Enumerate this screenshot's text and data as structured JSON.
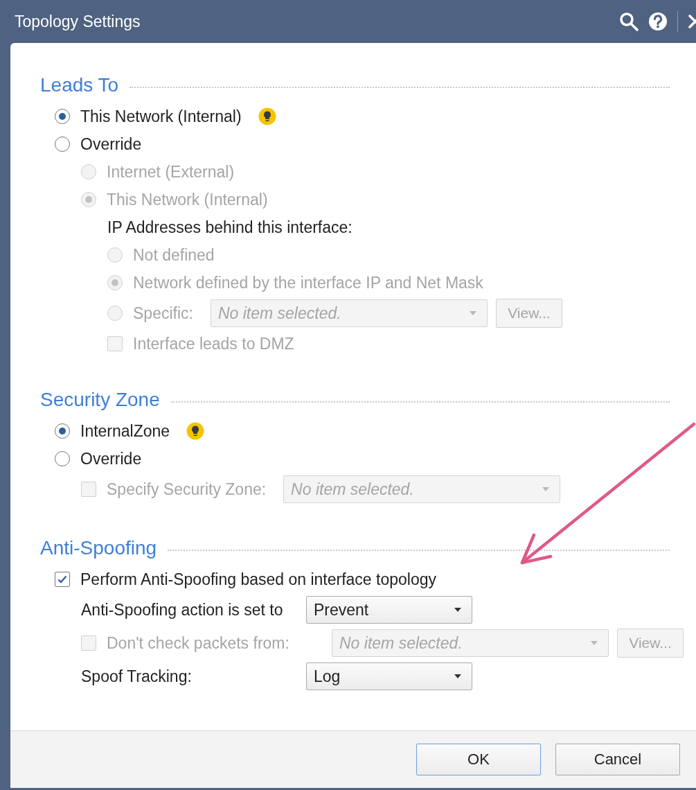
{
  "window": {
    "title": "Topology Settings"
  },
  "sections": [
    {
      "title": "Leads To",
      "items": [
        {
          "kind": "radio",
          "label": "This Network (Internal)",
          "selected": true,
          "disabled": false,
          "tip": true
        },
        {
          "kind": "radio",
          "label": "Override",
          "selected": false,
          "disabled": false,
          "children": [
            {
              "kind": "radio",
              "label": "Internet (External)",
              "selected": false,
              "disabled": true
            },
            {
              "kind": "radio",
              "label": "This Network (Internal)",
              "selected": true,
              "disabled": true,
              "children": [
                {
                  "kind": "label",
                  "label": "IP Addresses behind this interface:"
                },
                {
                  "kind": "radio",
                  "label": "Not defined",
                  "selected": false,
                  "disabled": true
                },
                {
                  "kind": "radio",
                  "label": "Network defined by the interface IP and Net Mask",
                  "selected": true,
                  "disabled": true
                },
                {
                  "kind": "radio",
                  "label": "Specific:",
                  "selected": false,
                  "disabled": true,
                  "combo": {
                    "placeholder": "No item selected.",
                    "disabled": true
                  },
                  "button": {
                    "label": "View...",
                    "disabled": true
                  }
                },
                {
                  "kind": "checkbox",
                  "label": "Interface leads to DMZ",
                  "checked": false,
                  "disabled": true
                }
              ]
            }
          ]
        }
      ]
    },
    {
      "title": "Security Zone",
      "items": [
        {
          "kind": "radio",
          "label": "InternalZone",
          "selected": true,
          "disabled": false,
          "tip": true
        },
        {
          "kind": "radio",
          "label": "Override",
          "selected": false,
          "disabled": false,
          "children": [
            {
              "kind": "checkbox",
              "label": "Specify Security Zone:",
              "checked": false,
              "disabled": true,
              "combo": {
                "placeholder": "No item selected.",
                "disabled": true
              }
            }
          ]
        }
      ]
    },
    {
      "title": "Anti-Spoofing",
      "items": [
        {
          "kind": "checkbox",
          "label": "Perform Anti-Spoofing based on interface topology",
          "checked": true,
          "disabled": false,
          "children": [
            {
              "kind": "label",
              "label": "Anti-Spoofing action is set to",
              "combo": {
                "value": "Prevent",
                "disabled": false
              }
            },
            {
              "kind": "checkbox",
              "label": "Don't check packets from:",
              "checked": false,
              "disabled": true,
              "combo": {
                "placeholder": "No item selected.",
                "disabled": true
              },
              "button": {
                "label": "View...",
                "disabled": true
              }
            },
            {
              "kind": "label",
              "label": "Spoof Tracking:",
              "combo": {
                "value": "Log",
                "disabled": false
              }
            }
          ]
        }
      ]
    }
  ],
  "buttons": [
    {
      "label": "OK",
      "default": true
    },
    {
      "label": "Cancel",
      "default": false
    }
  ],
  "annotations": [
    {
      "kind": "arrow"
    }
  ]
}
